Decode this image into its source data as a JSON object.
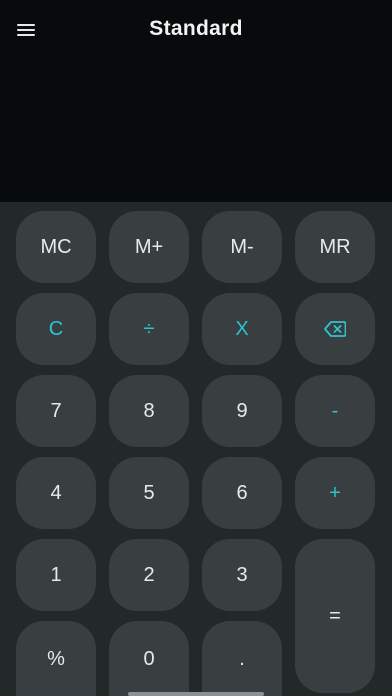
{
  "header": {
    "title": "Standard",
    "menu_icon": "hamburger-menu-icon"
  },
  "display": {
    "value": ""
  },
  "colors": {
    "background": "#232829",
    "header_background": "#070b0b",
    "key_background": "#393f40",
    "key_text": "#e8eaea",
    "accent": "#2ec4cf"
  },
  "memory_keys": {
    "mc": "MC",
    "m_plus": "M+",
    "m_minus": "M-",
    "mr": "MR"
  },
  "function_keys": {
    "clear": "C",
    "divide": "÷",
    "multiply": "X",
    "backspace_icon": "backspace-icon",
    "subtract": "-",
    "add": "+",
    "equals": "=",
    "percent": "%",
    "decimal": "."
  },
  "digits": {
    "d0": "0",
    "d1": "1",
    "d2": "2",
    "d3": "3",
    "d4": "4",
    "d5": "5",
    "d6": "6",
    "d7": "7",
    "d8": "8",
    "d9": "9"
  }
}
